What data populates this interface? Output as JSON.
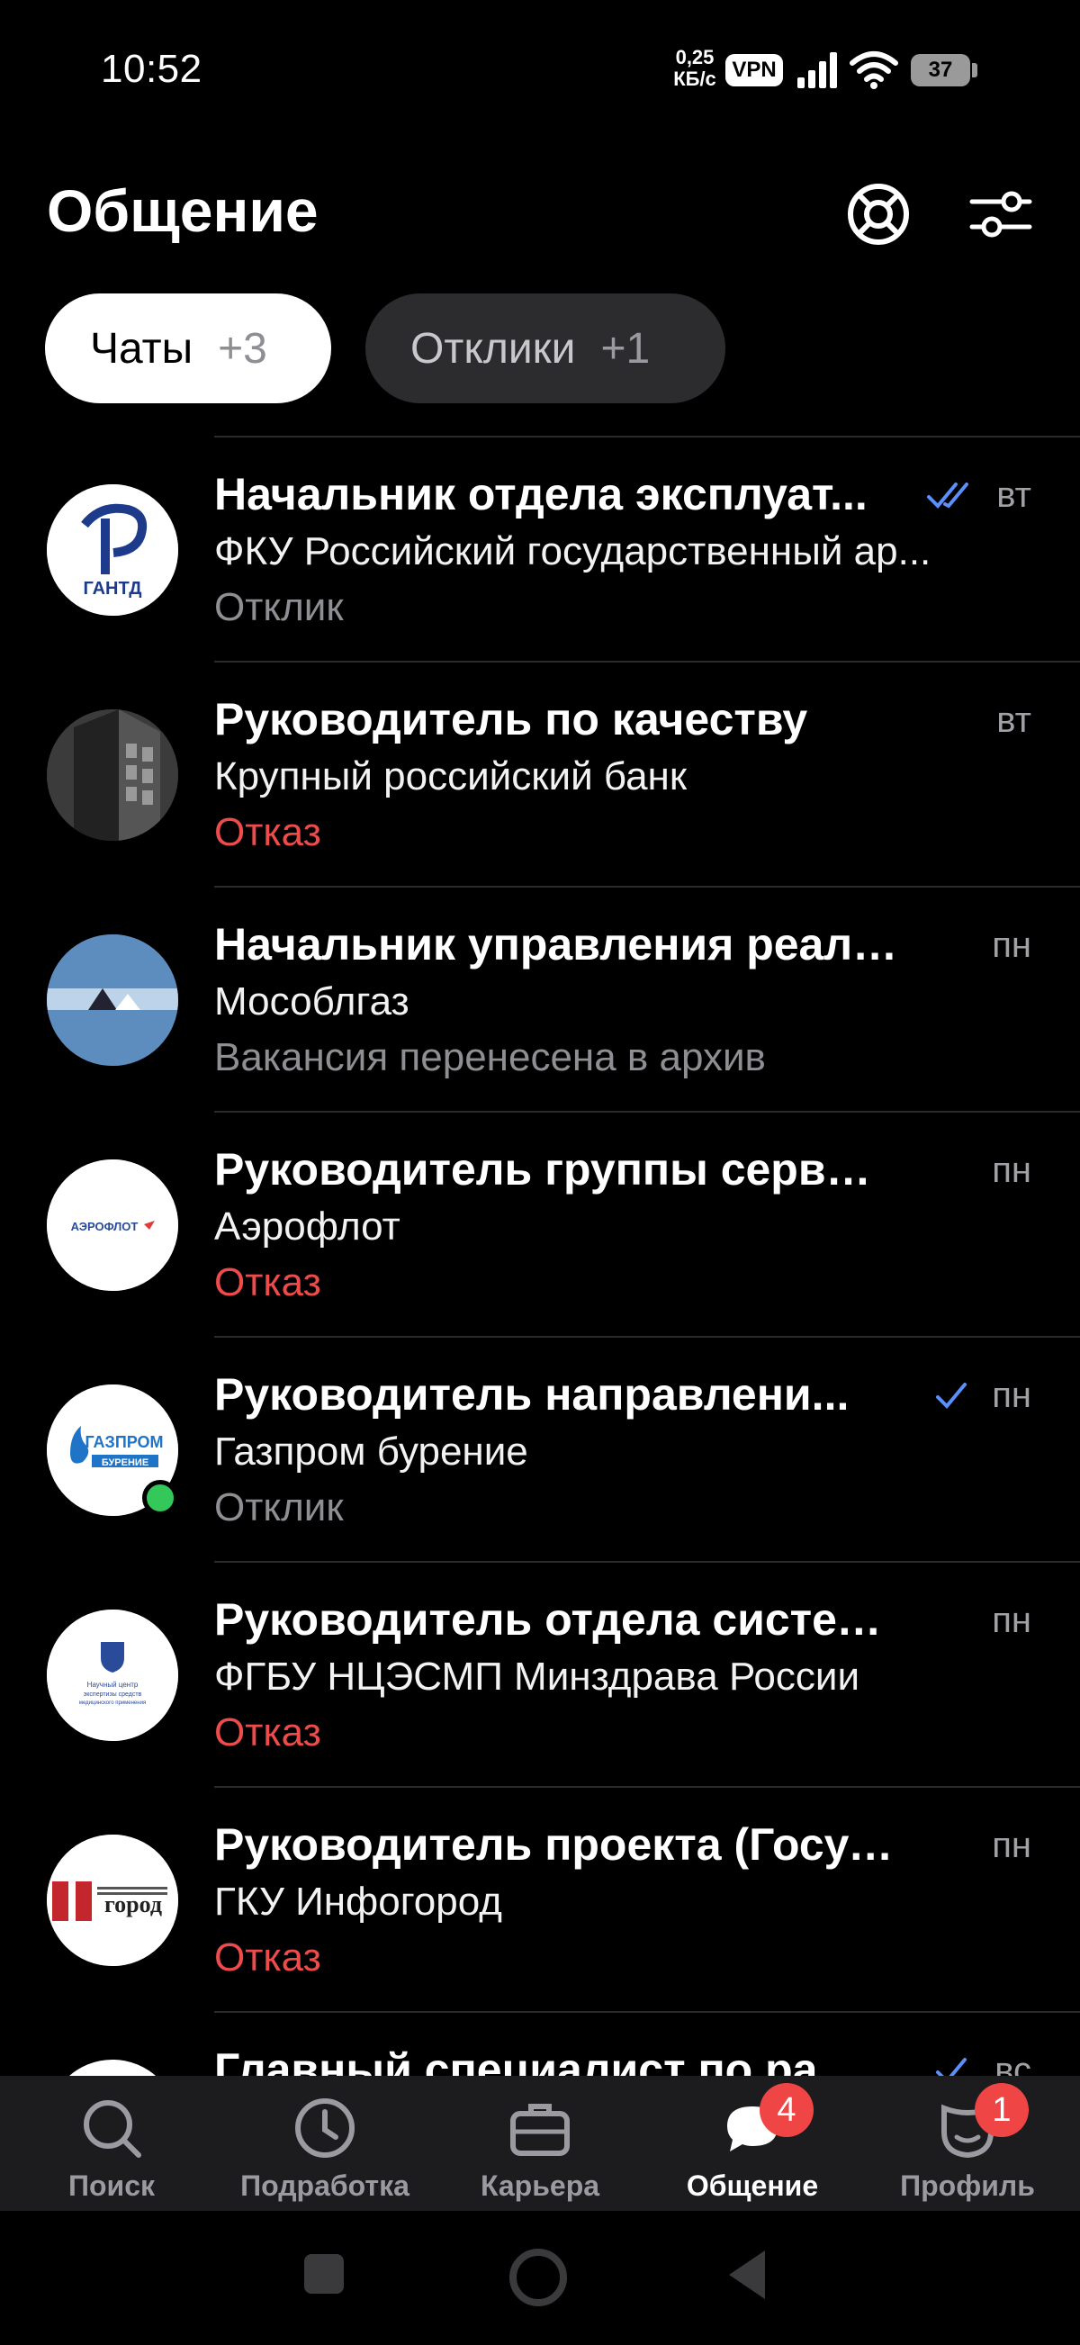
{
  "status_bar": {
    "time": "10:52",
    "net_speed_value": "0,25",
    "net_speed_unit": "КБ/с",
    "vpn": "VPN",
    "battery": "37"
  },
  "header": {
    "title": "Общение",
    "support_icon": "lifebuoy-icon",
    "filter_icon": "sliders-icon"
  },
  "tabs": [
    {
      "label": "Чаты",
      "count": "+3",
      "active": true
    },
    {
      "label": "Отклики",
      "count": "+1",
      "active": false
    }
  ],
  "chats": [
    {
      "title": "Начальник отдела эксплуат...",
      "company": "ФКУ Российский государственный ар...",
      "status": "Отклик",
      "status_type": "neutral",
      "day": "вт",
      "check": "double",
      "avatar": "ГАНТД"
    },
    {
      "title": "Руководитель по качеству",
      "company": "Крупный российский банк",
      "status": "Отказ",
      "status_type": "rejected",
      "day": "вт",
      "check": "none",
      "avatar": "building"
    },
    {
      "title": "Начальник управления реали...",
      "company": "Мособлгаз",
      "status": "Вакансия перенесена в архив",
      "status_type": "neutral",
      "day": "пн",
      "check": "none",
      "avatar": "mosoblgaz"
    },
    {
      "title": "Руководитель группы сервис...",
      "company": "Аэрофлот",
      "status": "Отказ",
      "status_type": "rejected",
      "day": "пн",
      "check": "none",
      "avatar": "АЭРОФЛОТ"
    },
    {
      "title": "Руководитель направлени...",
      "company": "Газпром бурение",
      "status": "Отклик",
      "status_type": "neutral",
      "day": "пн",
      "check": "single",
      "avatar": "ГАЗПРОМ БУРЕНИЕ",
      "online": true
    },
    {
      "title": "Руководитель отдела систем...",
      "company": "ФГБУ НЦЭСМП Минздрава России",
      "status": "Отказ",
      "status_type": "rejected",
      "day": "пн",
      "check": "none",
      "avatar": "Научный центр экспертизы средств медицинского применения"
    },
    {
      "title": "Руководитель проекта (Госус...",
      "company": "ГКУ Инфогород",
      "status": "Отказ",
      "status_type": "rejected",
      "day": "пн",
      "check": "none",
      "avatar": "город"
    },
    {
      "title": "Главный специалист по ра...",
      "company": "",
      "status": "",
      "status_type": "neutral",
      "day": "вс",
      "check": "single",
      "avatar": "partial"
    }
  ],
  "bottom_nav": [
    {
      "label": "Поиск",
      "icon": "search-icon",
      "badge": ""
    },
    {
      "label": "Подработка",
      "icon": "clock-icon",
      "badge": ""
    },
    {
      "label": "Карьера",
      "icon": "briefcase-icon",
      "badge": ""
    },
    {
      "label": "Общение",
      "icon": "chat-bubble-icon",
      "badge": "4",
      "active": true
    },
    {
      "label": "Профиль",
      "icon": "profile-mask-icon",
      "badge": "1"
    }
  ],
  "colors": {
    "rejected": "#ee4b4b",
    "check": "#5b8ff9",
    "online": "#34c759",
    "badge": "#f04545"
  }
}
